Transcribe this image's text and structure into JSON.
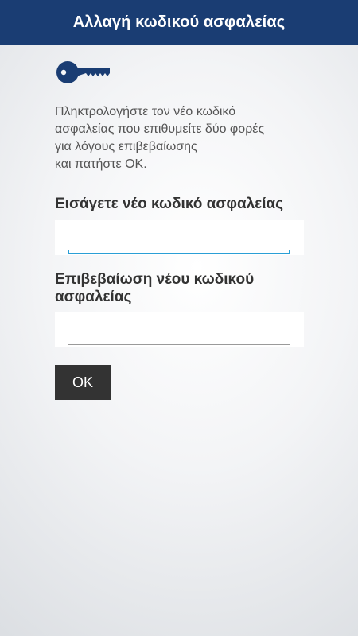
{
  "header": {
    "title": "Αλλαγή κωδικού ασφαλείας",
    "background_color": "#1a3d73"
  },
  "icon": {
    "name": "key-icon",
    "color": "#1a3d73"
  },
  "instructions": {
    "lines": [
      "Πληκτρολογήστε τον νέο κωδικό",
      "ασφαλείας που επιθυμείτε δύο φορές",
      "για λόγους επιβεβαίωσης",
      "και πατήστε ΟΚ."
    ]
  },
  "form": {
    "new_code": {
      "label": "Εισάγετε νέο κωδικό ασφαλείας",
      "value": "",
      "focused": true
    },
    "confirm_code": {
      "label": "Επιβεβαίωση νέου κωδικού ασφαλείας",
      "value": "",
      "focused": false
    },
    "ok_label": "OK"
  },
  "colors": {
    "focus_accent": "#2a9fd6",
    "button_bg": "#333333"
  }
}
